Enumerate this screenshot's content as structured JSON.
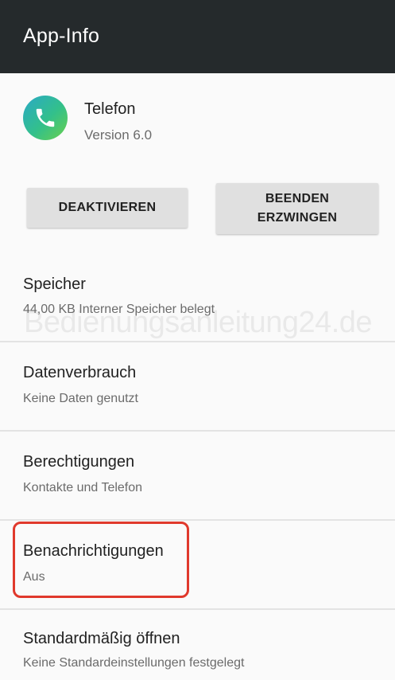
{
  "header": {
    "title": "App-Info"
  },
  "app": {
    "name": "Telefon",
    "version": "Version 6.0",
    "icon": "phone-icon"
  },
  "buttons": {
    "deactivate": "DEAKTIVIEREN",
    "force_stop_line1": "BEENDEN",
    "force_stop_line2": "ERZWINGEN"
  },
  "watermark": "Bedienungsanleitung24.de",
  "settings": [
    {
      "title": "Speicher",
      "subtitle": "44,00 KB Interner Speicher belegt"
    },
    {
      "title": "Datenverbrauch",
      "subtitle": "Keine Daten genutzt"
    },
    {
      "title": "Berechtigungen",
      "subtitle": "Kontakte und Telefon"
    },
    {
      "title": "Benachrichtigungen",
      "subtitle": "Aus"
    },
    {
      "title": "Standardmäßig öffnen",
      "subtitle": "Keine Standardeinstellungen festgelegt"
    }
  ],
  "colors": {
    "toolbar": "#252a2c",
    "highlight": "#e0392c",
    "button": "#e0e0e0"
  }
}
